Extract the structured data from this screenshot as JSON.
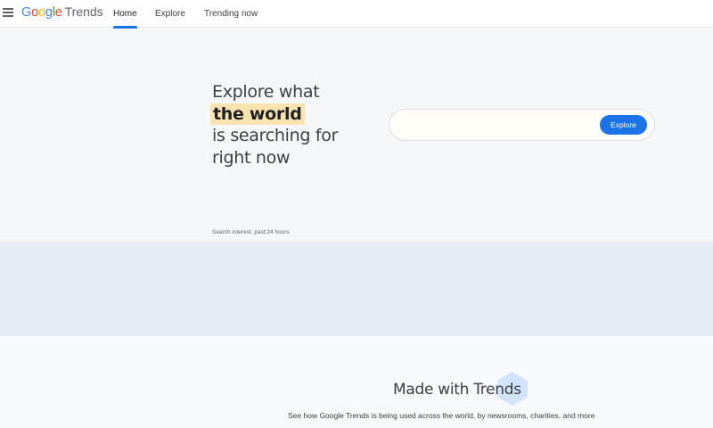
{
  "header": {
    "logo_google": "Google",
    "logo_trends": "Trends",
    "tabs": [
      {
        "label": "Home",
        "active": true
      },
      {
        "label": "Explore",
        "active": false
      },
      {
        "label": "Trending now",
        "active": false
      }
    ]
  },
  "hero": {
    "line1": "Explore what",
    "highlight": "the world",
    "line3": "is searching for",
    "line4": "right now",
    "search_placeholder": "",
    "search_button": "Explore",
    "interest_label": "Search interest, past 24 hours"
  },
  "made_with": {
    "title": "Made with Trends",
    "subtitle": "See how Google Trends is being used across the world, by newsrooms, charities, and more"
  },
  "icons": {
    "menu": "hamburger-menu-icon",
    "decoration": "hexagon-icon"
  },
  "colors": {
    "accent": "#1a73e8",
    "highlight": "#fbe3b0"
  }
}
